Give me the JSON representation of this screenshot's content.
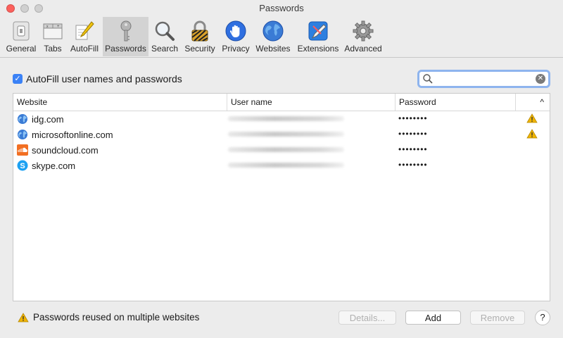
{
  "window": {
    "title": "Passwords"
  },
  "toolbar": {
    "items": [
      {
        "label": "General",
        "icon": "general-icon"
      },
      {
        "label": "Tabs",
        "icon": "tabs-icon"
      },
      {
        "label": "AutoFill",
        "icon": "autofill-icon"
      },
      {
        "label": "Passwords",
        "icon": "key-icon",
        "active": true
      },
      {
        "label": "Search",
        "icon": "magnifier-icon"
      },
      {
        "label": "Security",
        "icon": "lock-icon"
      },
      {
        "label": "Privacy",
        "icon": "hand-icon"
      },
      {
        "label": "Websites",
        "icon": "globe-icon"
      },
      {
        "label": "Extensions",
        "icon": "puzzle-icon"
      },
      {
        "label": "Advanced",
        "icon": "gear-icon"
      }
    ]
  },
  "autofill": {
    "label": "AutoFill user names and passwords",
    "checked": true
  },
  "search": {
    "value": ""
  },
  "table": {
    "columns": {
      "website": "Website",
      "username": "User name",
      "password": "Password",
      "sort": "^"
    },
    "rows": [
      {
        "site": "idg.com",
        "favicon": "globe",
        "password": "••••••••",
        "warning": true
      },
      {
        "site": "microsoftonline.com",
        "favicon": "globe",
        "password": "••••••••",
        "warning": true
      },
      {
        "site": "soundcloud.com",
        "favicon": "soundcloud",
        "password": "••••••••",
        "warning": false
      },
      {
        "site": "skype.com",
        "favicon": "skype",
        "password": "••••••••",
        "warning": false
      }
    ]
  },
  "footer": {
    "warning_text": "Passwords reused on multiple websites",
    "details_label": "Details...",
    "add_label": "Add",
    "remove_label": "Remove",
    "help_label": "?"
  },
  "colors": {
    "accent": "#3b82f6",
    "warning": "#f0b400",
    "selected_tool": "#d3d3d3"
  }
}
